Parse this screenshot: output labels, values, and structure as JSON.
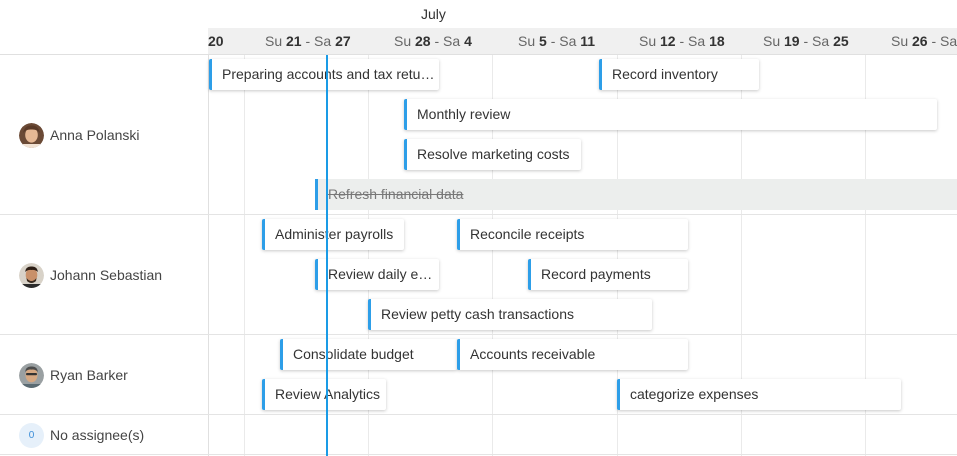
{
  "timeline": {
    "month": "July",
    "weeks": [
      {
        "pre": "",
        "bold1": "20",
        "mid": "",
        "bold2": ""
      },
      {
        "pre": "Su ",
        "bold1": "21",
        "mid": " - Sa ",
        "bold2": "27"
      },
      {
        "pre": "Su ",
        "bold1": "28",
        "mid": " - Sa ",
        "bold2": "4"
      },
      {
        "pre": "Su ",
        "bold1": "5",
        "mid": " - Sa ",
        "bold2": "11"
      },
      {
        "pre": "Su ",
        "bold1": "12",
        "mid": " - Sa ",
        "bold2": "18"
      },
      {
        "pre": "Su ",
        "bold1": "19",
        "mid": " - Sa ",
        "bold2": "25"
      },
      {
        "pre": "Su ",
        "bold1": "26",
        "mid": " - Sa",
        "bold2": ""
      }
    ]
  },
  "colors": {
    "accent": "#2d9ee8",
    "today": "#1a9be6",
    "header_bg": "#f0f0f0",
    "done_bg": "#eceeed"
  },
  "assignees": [
    {
      "name": "Anna Polanski",
      "avatar": "female-avatar"
    },
    {
      "name": "Johann Sebastian",
      "avatar": "male-avatar"
    },
    {
      "name": "Ryan Barker",
      "avatar": "male-avatar-2"
    },
    {
      "name": "No assignee(s)",
      "count": "0"
    }
  ],
  "tasks": [
    {
      "label": "Preparing accounts and tax returns",
      "assignee": "Anna Polanski",
      "done": false
    },
    {
      "label": "Record inventory",
      "assignee": "Anna Polanski",
      "done": false
    },
    {
      "label": "Monthly review",
      "assignee": "Anna Polanski",
      "done": false
    },
    {
      "label": "Resolve marketing costs",
      "assignee": "Anna Polanski",
      "done": false
    },
    {
      "label": "Refresh financial data",
      "assignee": "Anna Polanski",
      "done": true
    },
    {
      "label": "Administer payrolls",
      "assignee": "Johann Sebastian",
      "done": false
    },
    {
      "label": "Reconcile receipts",
      "assignee": "Johann Sebastian",
      "done": false
    },
    {
      "label": "Review daily expenses",
      "assignee": "Johann Sebastian",
      "done": false
    },
    {
      "label": "Record payments",
      "assignee": "Johann Sebastian",
      "done": false
    },
    {
      "label": "Review petty cash transactions",
      "assignee": "Johann Sebastian",
      "done": false
    },
    {
      "label": "Consolidate budget",
      "assignee": "Ryan Barker",
      "done": false
    },
    {
      "label": "Accounts receivable",
      "assignee": "Ryan Barker",
      "done": false
    },
    {
      "label": "Review Analytics",
      "assignee": "Ryan Barker",
      "done": false
    },
    {
      "label": "categorize expenses",
      "assignee": "Ryan Barker",
      "done": false
    }
  ]
}
